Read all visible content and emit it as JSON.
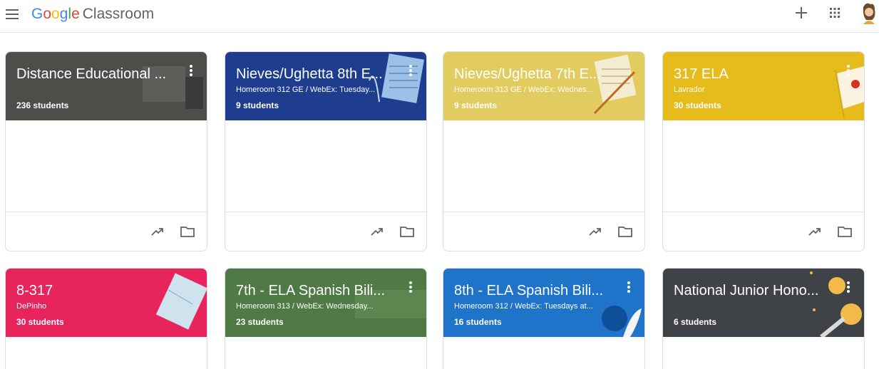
{
  "app": {
    "logo_letters": [
      "G",
      "o",
      "o",
      "g",
      "l",
      "e"
    ],
    "product_name": "Classroom",
    "menu_icon": "hamburger-menu-icon",
    "create_icon": "plus-icon",
    "apps_icon": "apps-grid-icon",
    "avatar_icon": "avatar"
  },
  "classes": [
    {
      "title": "Distance Educational ...",
      "subtitle": "",
      "students": "236 students",
      "banner_color": "#4d4e4a",
      "has_menu": true
    },
    {
      "title": "Nieves/Ughetta 8th E...",
      "subtitle": "Homeroom 312 GE / WebEx: Tuesday...",
      "students": "9 students",
      "banner_color": "#1e3d8f",
      "has_menu": true
    },
    {
      "title": "Nieves/Ughetta 7th E...",
      "subtitle": "Homeroom 313 GE / WebEx: Wednes...",
      "students": "9 students",
      "banner_color": "#e2cb5f",
      "has_menu": false
    },
    {
      "title": "317 ELA",
      "subtitle": "Lavrador",
      "students": "30 students",
      "banner_color": "#e6bb1c",
      "has_menu": true
    },
    {
      "title": "8-317",
      "subtitle": "DePinho",
      "students": "30 students",
      "banner_color": "#e8245d",
      "has_menu": false
    },
    {
      "title": "7th - ELA Spanish Bili...",
      "subtitle": "Homeroom 313 / WebEx: Wednesday...",
      "students": "23 students",
      "banner_color": "#4f7a45",
      "has_menu": true
    },
    {
      "title": "8th - ELA Spanish Bili...",
      "subtitle": "Homeroom 312 / WebEx: Tuesdays at...",
      "students": "16 students",
      "banner_color": "#1f73c9",
      "has_menu": true
    },
    {
      "title": "National Junior Hono...",
      "subtitle": "",
      "students": "6 students",
      "banner_color": "#3f4347",
      "has_menu": true
    }
  ],
  "card_actions": {
    "trend_icon": "trending-up-icon",
    "folder_icon": "folder-icon"
  }
}
